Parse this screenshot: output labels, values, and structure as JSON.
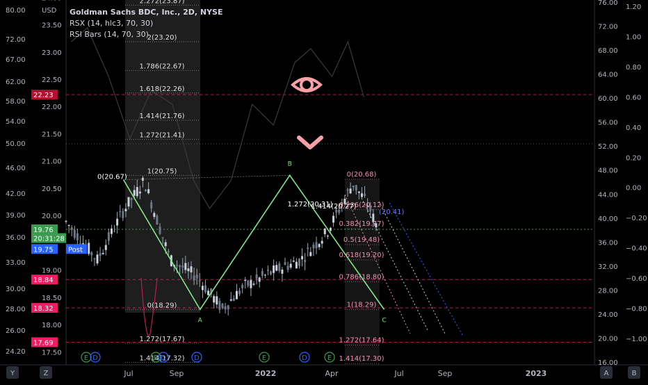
{
  "chart": {
    "symbol_title": "Goldman Sachs BDC, Inc., 2D, NYSE",
    "currency": "USD",
    "indicators": [
      "RSX (14, hlc3, 70, 30)",
      "RSI Bars (14, 70, 30)"
    ]
  },
  "price_axis_outer": {
    "ticks": [
      {
        "label": "80.00",
        "v": 80
      },
      {
        "label": "72.00",
        "v": 72
      },
      {
        "label": "67.00",
        "v": 67
      },
      {
        "label": "62.00",
        "v": 62
      },
      {
        "label": "58.00",
        "v": 58
      },
      {
        "label": "54.00",
        "v": 54
      },
      {
        "label": "50.00",
        "v": 50
      },
      {
        "label": "46.00",
        "v": 46
      },
      {
        "label": "42.00",
        "v": 42
      },
      {
        "label": "39.00",
        "v": 39
      },
      {
        "label": "36.00",
        "v": 36
      },
      {
        "label": "33.00",
        "v": 33
      },
      {
        "label": "30.00",
        "v": 30
      },
      {
        "label": "28.00",
        "v": 28
      },
      {
        "label": "26.00",
        "v": 26
      },
      {
        "label": "24.20",
        "v": 24.2
      }
    ]
  },
  "price_axis_inner": {
    "ticks": [
      {
        "label": "24.00",
        "v": 24
      },
      {
        "label": "23.50",
        "v": 23.5
      },
      {
        "label": "23.00",
        "v": 23
      },
      {
        "label": "22.50",
        "v": 22.5
      },
      {
        "label": "22.00",
        "v": 22
      },
      {
        "label": "21.50",
        "v": 21.5
      },
      {
        "label": "21.00",
        "v": 21
      },
      {
        "label": "20.50",
        "v": 20.5
      },
      {
        "label": "20.00",
        "v": 20
      },
      {
        "label": "19.00",
        "v": 19
      },
      {
        "label": "18.50",
        "v": 18.5
      },
      {
        "label": "18.00",
        "v": 18
      },
      {
        "label": "17.50",
        "v": 17.5
      }
    ]
  },
  "price_tags": [
    {
      "label": "22.23",
      "v": 22.23,
      "color": "#b2102f"
    },
    {
      "label": "19.76",
      "v": 19.76,
      "color": "#3c9a51"
    },
    {
      "label": "20:31:28",
      "v": 19.6,
      "color": "#3c9a51"
    },
    {
      "label": "19.75",
      "v": 19.4,
      "color": "#2962ff"
    },
    {
      "label": "18.84",
      "v": 18.84,
      "color": "#e91e63"
    },
    {
      "label": "18.32",
      "v": 18.32,
      "color": "#e91e63"
    },
    {
      "label": "17.69",
      "v": 17.69,
      "color": "#e91e63"
    }
  ],
  "post_label": "Post",
  "right_axis_a": {
    "ticks": [
      {
        "label": "76.00",
        "v": 76
      },
      {
        "label": "72.00",
        "v": 72
      },
      {
        "label": "68.00",
        "v": 68
      },
      {
        "label": "64.00",
        "v": 64
      },
      {
        "label": "60.00",
        "v": 60
      },
      {
        "label": "56.00",
        "v": 56
      },
      {
        "label": "52.00",
        "v": 52
      },
      {
        "label": "48.00",
        "v": 48
      },
      {
        "label": "44.00",
        "v": 44
      },
      {
        "label": "40.00",
        "v": 40
      },
      {
        "label": "36.00",
        "v": 36
      },
      {
        "label": "32.00",
        "v": 32
      },
      {
        "label": "28.00",
        "v": 28
      },
      {
        "label": "24.00",
        "v": 24
      },
      {
        "label": "20.00",
        "v": 20
      },
      {
        "label": "16.00",
        "v": 16
      }
    ]
  },
  "right_axis_b": {
    "ticks": [
      {
        "label": "1.20",
        "v": 1.2
      },
      {
        "label": "1.00",
        "v": 1.0
      },
      {
        "label": "0.80",
        "v": 0.8
      },
      {
        "label": "0.60",
        "v": 0.6
      },
      {
        "label": "0.40",
        "v": 0.4
      },
      {
        "label": "0.20",
        "v": 0.2
      },
      {
        "label": "0.00",
        "v": 0
      },
      {
        "label": "−0.20",
        "v": -0.2
      },
      {
        "label": "−0.40",
        "v": -0.4
      },
      {
        "label": "−0.60",
        "v": -0.6
      },
      {
        "label": "−0.80",
        "v": -0.8
      },
      {
        "label": "−1.00",
        "v": -1.0
      }
    ]
  },
  "time_axis": {
    "labels": [
      "Y",
      "Z",
      "Jul",
      "Sep",
      "2022",
      "Apr",
      "Jul",
      "Sep",
      "2023",
      "A",
      "B"
    ]
  },
  "fib_extension_left": {
    "levels": [
      {
        "label": "2.272(23.87)",
        "v": 23.87
      },
      {
        "label": "2(23.20)",
        "v": 23.2
      },
      {
        "label": "1.786(22.67)",
        "v": 22.67
      },
      {
        "label": "1.618(22.26)",
        "v": 22.26
      },
      {
        "label": "1.414(21.76)",
        "v": 21.76
      },
      {
        "label": "1.272(21.41)",
        "v": 21.41
      },
      {
        "label": "1(20.75)",
        "v": 20.75
      },
      {
        "label": "0(18.29)",
        "v": 18.29
      },
      {
        "label": "1.272(17.67)",
        "v": 17.67
      },
      {
        "label": "1.414(17.32)",
        "v": 17.32
      }
    ],
    "start_label": "0(20.67)"
  },
  "fib_retracement_right": {
    "levels": [
      {
        "label": "0(20.68)",
        "v": 20.68
      },
      {
        "label": "0.236(20.12)",
        "v": 20.12
      },
      {
        "label": "0.382(19.77)",
        "v": 19.77
      },
      {
        "label": "0.5(19.48)",
        "v": 19.48
      },
      {
        "label": "0.618(19.20)",
        "v": 19.2
      },
      {
        "label": "0.786(18.80)",
        "v": 18.8
      },
      {
        "label": "1(18.29)",
        "v": 18.29
      },
      {
        "label": "1.272(17.64)",
        "v": 17.64
      },
      {
        "label": "1.414(17.30)",
        "v": 17.3
      }
    ],
    "extra_labels": [
      "1.272(20.31)",
      "1.414(20.27)",
      "(20.41)"
    ]
  },
  "abc_pattern": {
    "points": [
      {
        "label": "",
        "v": 20.67
      },
      {
        "label": "A",
        "v": 18.29
      },
      {
        "label": "B",
        "v": 20.75
      },
      {
        "label": "C",
        "v": 18.29
      }
    ]
  },
  "markers": [
    "E",
    "D",
    "E",
    "D",
    "D",
    "E",
    "D",
    "E"
  ],
  "colors": {
    "bg": "#000000",
    "candle": "#9aa7b4",
    "abc": "#7ee787",
    "fib_pink": "#f48fb1",
    "level_line": "#e91e63",
    "dotted_green": "#3c9a51",
    "dotted_blue": "#2962ff",
    "eye": "#f8a0a8",
    "shade": "#2a2a2a"
  },
  "icons": [
    "eye-icon",
    "chevron-down-icon"
  ]
}
